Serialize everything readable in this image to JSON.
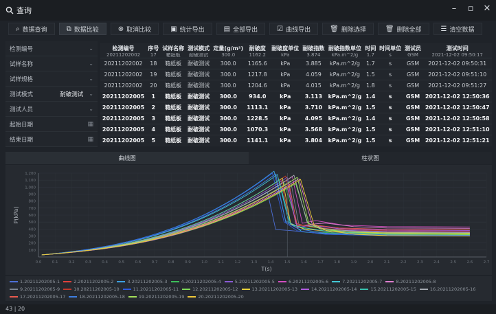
{
  "window": {
    "title": "查询"
  },
  "toolbar": {
    "buttons": [
      {
        "label": "数据查询",
        "icon": "search-icon",
        "glyph": "⌕",
        "active": false
      },
      {
        "label": "数据比较",
        "icon": "compare-icon",
        "glyph": "⧉",
        "active": true
      },
      {
        "label": "取消比较",
        "icon": "cancel-icon",
        "glyph": "⊗",
        "active": false
      },
      {
        "label": "统计导出",
        "icon": "stats-export-icon",
        "glyph": "▣",
        "active": false
      },
      {
        "label": "全部导出",
        "icon": "export-all-icon",
        "glyph": "▤",
        "active": false
      },
      {
        "label": "曲线导出",
        "icon": "curve-export-icon",
        "glyph": "☑",
        "active": false
      },
      {
        "label": "删除选择",
        "icon": "delete-selected-icon",
        "glyph": "🗑",
        "active": false
      },
      {
        "label": "删除全部",
        "icon": "delete-all-icon",
        "glyph": "🗑",
        "active": false
      },
      {
        "label": "清空数据",
        "icon": "clear-data-icon",
        "glyph": "☰",
        "active": false
      }
    ]
  },
  "filters": [
    {
      "label": "检测编号",
      "value": "",
      "control": "dropdown"
    },
    {
      "label": "试样名称",
      "value": "",
      "control": "dropdown"
    },
    {
      "label": "试样规格",
      "value": "",
      "control": "dropdown"
    },
    {
      "label": "测试模式",
      "value": "耐破测试",
      "control": "dropdown"
    },
    {
      "label": "测试人员",
      "value": "",
      "control": "dropdown"
    },
    {
      "label": "起始日期",
      "value": "",
      "control": "calendar"
    },
    {
      "label": "结束日期",
      "value": "",
      "control": "calendar"
    }
  ],
  "table": {
    "headers": [
      "检测编号",
      "序号",
      "试样名称",
      "测试模式",
      "定量(g/m²)",
      "耐破度",
      "耐破度单位",
      "耐破指数",
      "耐破指数单位",
      "时间",
      "时间单位",
      "测试员",
      "测试时间"
    ],
    "partial_row": [
      "20211202002",
      "17",
      "箱纸板",
      "耐破测试",
      "300.0",
      "1162.2",
      "kPa",
      "3.874",
      "kPa.m^2/g",
      "1.7",
      "s",
      "GSM",
      "2021-12-02 09:50:17"
    ],
    "rows": [
      {
        "highlight": false,
        "cells": [
          "20211202002",
          "18",
          "箱纸板",
          "耐破测试",
          "300.0",
          "1165.6",
          "kPa",
          "3.885",
          "kPa.m^2/g",
          "1.7",
          "s",
          "GSM",
          "2021-12-02 09:50:31"
        ]
      },
      {
        "highlight": false,
        "cells": [
          "20211202002",
          "19",
          "箱纸板",
          "耐破测试",
          "300.0",
          "1217.8",
          "kPa",
          "4.059",
          "kPa.m^2/g",
          "1.5",
          "s",
          "GSM",
          "2021-12-02 09:51:10"
        ]
      },
      {
        "highlight": false,
        "cells": [
          "20211202002",
          "20",
          "箱纸板",
          "耐破测试",
          "300.0",
          "1204.6",
          "kPa",
          "4.015",
          "kPa.m^2/g",
          "1.8",
          "s",
          "GSM",
          "2021-12-02 09:51:27"
        ]
      },
      {
        "highlight": true,
        "cells": [
          "20211202005",
          "1",
          "箱纸板",
          "耐破测试",
          "300.0",
          "934.0",
          "kPa",
          "3.113",
          "kPa.m^2/g",
          "1.4",
          "s",
          "GSM",
          "2021-12-02 12:50:36"
        ]
      },
      {
        "highlight": true,
        "cells": [
          "20211202005",
          "2",
          "箱纸板",
          "耐破测试",
          "300.0",
          "1113.1",
          "kPa",
          "3.710",
          "kPa.m^2/g",
          "1.5",
          "s",
          "GSM",
          "2021-12-02 12:50:47"
        ]
      },
      {
        "highlight": true,
        "cells": [
          "20211202005",
          "3",
          "箱纸板",
          "耐破测试",
          "300.0",
          "1228.5",
          "kPa",
          "4.095",
          "kPa.m^2/g",
          "1.4",
          "s",
          "GSM",
          "2021-12-02 12:50:58"
        ]
      },
      {
        "highlight": true,
        "cells": [
          "20211202005",
          "4",
          "箱纸板",
          "耐破测试",
          "300.0",
          "1070.3",
          "kPa",
          "3.568",
          "kPa.m^2/g",
          "1.5",
          "s",
          "GSM",
          "2021-12-02 12:51:10"
        ]
      },
      {
        "highlight": true,
        "cells": [
          "20211202005",
          "5",
          "箱纸板",
          "耐破测试",
          "300.0",
          "1141.1",
          "kPa",
          "3.804",
          "kPa.m^2/g",
          "1.5",
          "s",
          "GSM",
          "2021-12-02 12:51:21"
        ]
      }
    ]
  },
  "tabs": [
    {
      "label": "曲线图",
      "active": true
    },
    {
      "label": "柱状图",
      "active": false
    }
  ],
  "chart_data": {
    "type": "line",
    "xlabel": "T(s)",
    "ylabel": "P(kPa)",
    "xlim": [
      0,
      2.7
    ],
    "ylim": [
      0,
      1200
    ],
    "xticks": [
      "0.0",
      "0.1",
      "0.2",
      "0.3",
      "0.4",
      "0.5",
      "0.6",
      "0.7",
      "0.8",
      "0.9",
      "1.0",
      "1.1",
      "1.2",
      "1.3",
      "1.4",
      "1.5",
      "1.6",
      "1.7",
      "1.8",
      "1.9",
      "2.0",
      "2.1",
      "2.2",
      "2.3",
      "2.4",
      "2.5",
      "2.6",
      "2.7"
    ],
    "yticks": [
      "100",
      "200",
      "300",
      "400",
      "500",
      "600",
      "700",
      "800",
      "900",
      "1,000",
      "1,100",
      "1,200"
    ],
    "grid": true,
    "legend_position": "bottom",
    "series": [
      {
        "name": "1.20211202005-1",
        "color": "#4d6fd6",
        "peak_t": 1.38,
        "peak_p": 934.0,
        "tail_p": 320
      },
      {
        "name": "2.20211202005-2",
        "color": "#e0413b",
        "peak_t": 1.46,
        "peak_p": 1113.1,
        "tail_p": 330
      },
      {
        "name": "3.20211202005-3",
        "color": "#3da0e0",
        "peak_t": 1.42,
        "peak_p": 1228.5,
        "tail_p": 340
      },
      {
        "name": "4.20211202005-4",
        "color": "#3cbf5a",
        "peak_t": 1.48,
        "peak_p": 1070.3,
        "tail_p": 310
      },
      {
        "name": "5.20211202005-5",
        "color": "#8a5bd6",
        "peak_t": 1.5,
        "peak_p": 1141.1,
        "tail_p": 360
      },
      {
        "name": "6.20211202005-6",
        "color": "#d24ec0",
        "peak_t": 1.53,
        "peak_p": 1150,
        "tail_p": 430
      },
      {
        "name": "7.20211202005-7",
        "color": "#43c7d6",
        "peak_t": 1.44,
        "peak_p": 1180,
        "tail_p": 300
      },
      {
        "name": "8.20211202005-8",
        "color": "#e07fd0",
        "peak_t": 1.57,
        "peak_p": 1120,
        "tail_p": 410
      },
      {
        "name": "9.20211202005-9",
        "color": "#7d8590",
        "peak_t": 1.52,
        "peak_p": 1090,
        "tail_p": 350
      },
      {
        "name": "10.20211202005-10",
        "color": "#c0392b",
        "peak_t": 1.49,
        "peak_p": 1160,
        "tail_p": 370
      },
      {
        "name": "11.20211202005-11",
        "color": "#2f5ad9",
        "peak_t": 1.41,
        "peak_p": 1200,
        "tail_p": 300
      },
      {
        "name": "12.20211202005-12",
        "color": "#7ed957",
        "peak_t": 1.55,
        "peak_p": 1050,
        "tail_p": 320
      },
      {
        "name": "13.20211202005-13",
        "color": "#e8d23a",
        "peak_t": 1.47,
        "peak_p": 1130,
        "tail_p": 340
      },
      {
        "name": "14.20211202005-14",
        "color": "#b05ce0",
        "peak_t": 1.5,
        "peak_p": 1000,
        "tail_p": 380
      },
      {
        "name": "15.20211202005-15",
        "color": "#39c3b0",
        "peak_t": 1.45,
        "peak_p": 1100,
        "tail_p": 330
      },
      {
        "name": "16.20211202005-16",
        "color": "#a6abb2",
        "peak_t": 1.54,
        "peak_p": 1170,
        "tail_p": 350
      },
      {
        "name": "17.20211202005-17",
        "color": "#e85a4f",
        "peak_t": 1.51,
        "peak_p": 1060,
        "tail_p": 390
      },
      {
        "name": "18.20211202005-18",
        "color": "#3f7fe0",
        "peak_t": 1.43,
        "peak_p": 1190,
        "tail_p": 310
      },
      {
        "name": "19.20211202005-19",
        "color": "#a5e05a",
        "peak_t": 1.56,
        "peak_p": 1140,
        "tail_p": 330
      },
      {
        "name": "20.20211202005-20",
        "color": "#f0c93a",
        "peak_t": 1.58,
        "peak_p": 1110,
        "tail_p": 300
      }
    ]
  },
  "statusbar": {
    "text": "43 | 20"
  }
}
